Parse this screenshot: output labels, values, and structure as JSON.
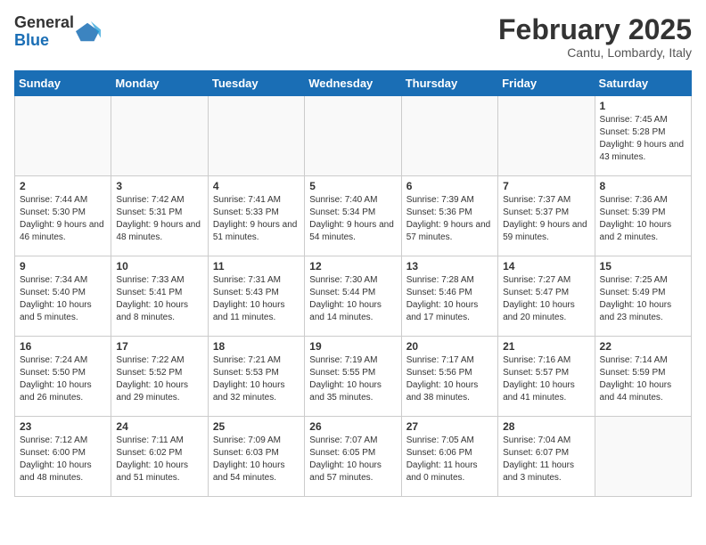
{
  "logo": {
    "general": "General",
    "blue": "Blue"
  },
  "title": "February 2025",
  "subtitle": "Cantu, Lombardy, Italy",
  "days_of_week": [
    "Sunday",
    "Monday",
    "Tuesday",
    "Wednesday",
    "Thursday",
    "Friday",
    "Saturday"
  ],
  "weeks": [
    [
      {
        "day": "",
        "info": ""
      },
      {
        "day": "",
        "info": ""
      },
      {
        "day": "",
        "info": ""
      },
      {
        "day": "",
        "info": ""
      },
      {
        "day": "",
        "info": ""
      },
      {
        "day": "",
        "info": ""
      },
      {
        "day": "1",
        "info": "Sunrise: 7:45 AM\nSunset: 5:28 PM\nDaylight: 9 hours and 43 minutes."
      }
    ],
    [
      {
        "day": "2",
        "info": "Sunrise: 7:44 AM\nSunset: 5:30 PM\nDaylight: 9 hours and 46 minutes."
      },
      {
        "day": "3",
        "info": "Sunrise: 7:42 AM\nSunset: 5:31 PM\nDaylight: 9 hours and 48 minutes."
      },
      {
        "day": "4",
        "info": "Sunrise: 7:41 AM\nSunset: 5:33 PM\nDaylight: 9 hours and 51 minutes."
      },
      {
        "day": "5",
        "info": "Sunrise: 7:40 AM\nSunset: 5:34 PM\nDaylight: 9 hours and 54 minutes."
      },
      {
        "day": "6",
        "info": "Sunrise: 7:39 AM\nSunset: 5:36 PM\nDaylight: 9 hours and 57 minutes."
      },
      {
        "day": "7",
        "info": "Sunrise: 7:37 AM\nSunset: 5:37 PM\nDaylight: 9 hours and 59 minutes."
      },
      {
        "day": "8",
        "info": "Sunrise: 7:36 AM\nSunset: 5:39 PM\nDaylight: 10 hours and 2 minutes."
      }
    ],
    [
      {
        "day": "9",
        "info": "Sunrise: 7:34 AM\nSunset: 5:40 PM\nDaylight: 10 hours and 5 minutes."
      },
      {
        "day": "10",
        "info": "Sunrise: 7:33 AM\nSunset: 5:41 PM\nDaylight: 10 hours and 8 minutes."
      },
      {
        "day": "11",
        "info": "Sunrise: 7:31 AM\nSunset: 5:43 PM\nDaylight: 10 hours and 11 minutes."
      },
      {
        "day": "12",
        "info": "Sunrise: 7:30 AM\nSunset: 5:44 PM\nDaylight: 10 hours and 14 minutes."
      },
      {
        "day": "13",
        "info": "Sunrise: 7:28 AM\nSunset: 5:46 PM\nDaylight: 10 hours and 17 minutes."
      },
      {
        "day": "14",
        "info": "Sunrise: 7:27 AM\nSunset: 5:47 PM\nDaylight: 10 hours and 20 minutes."
      },
      {
        "day": "15",
        "info": "Sunrise: 7:25 AM\nSunset: 5:49 PM\nDaylight: 10 hours and 23 minutes."
      }
    ],
    [
      {
        "day": "16",
        "info": "Sunrise: 7:24 AM\nSunset: 5:50 PM\nDaylight: 10 hours and 26 minutes."
      },
      {
        "day": "17",
        "info": "Sunrise: 7:22 AM\nSunset: 5:52 PM\nDaylight: 10 hours and 29 minutes."
      },
      {
        "day": "18",
        "info": "Sunrise: 7:21 AM\nSunset: 5:53 PM\nDaylight: 10 hours and 32 minutes."
      },
      {
        "day": "19",
        "info": "Sunrise: 7:19 AM\nSunset: 5:55 PM\nDaylight: 10 hours and 35 minutes."
      },
      {
        "day": "20",
        "info": "Sunrise: 7:17 AM\nSunset: 5:56 PM\nDaylight: 10 hours and 38 minutes."
      },
      {
        "day": "21",
        "info": "Sunrise: 7:16 AM\nSunset: 5:57 PM\nDaylight: 10 hours and 41 minutes."
      },
      {
        "day": "22",
        "info": "Sunrise: 7:14 AM\nSunset: 5:59 PM\nDaylight: 10 hours and 44 minutes."
      }
    ],
    [
      {
        "day": "23",
        "info": "Sunrise: 7:12 AM\nSunset: 6:00 PM\nDaylight: 10 hours and 48 minutes."
      },
      {
        "day": "24",
        "info": "Sunrise: 7:11 AM\nSunset: 6:02 PM\nDaylight: 10 hours and 51 minutes."
      },
      {
        "day": "25",
        "info": "Sunrise: 7:09 AM\nSunset: 6:03 PM\nDaylight: 10 hours and 54 minutes."
      },
      {
        "day": "26",
        "info": "Sunrise: 7:07 AM\nSunset: 6:05 PM\nDaylight: 10 hours and 57 minutes."
      },
      {
        "day": "27",
        "info": "Sunrise: 7:05 AM\nSunset: 6:06 PM\nDaylight: 11 hours and 0 minutes."
      },
      {
        "day": "28",
        "info": "Sunrise: 7:04 AM\nSunset: 6:07 PM\nDaylight: 11 hours and 3 minutes."
      },
      {
        "day": "",
        "info": ""
      }
    ]
  ]
}
